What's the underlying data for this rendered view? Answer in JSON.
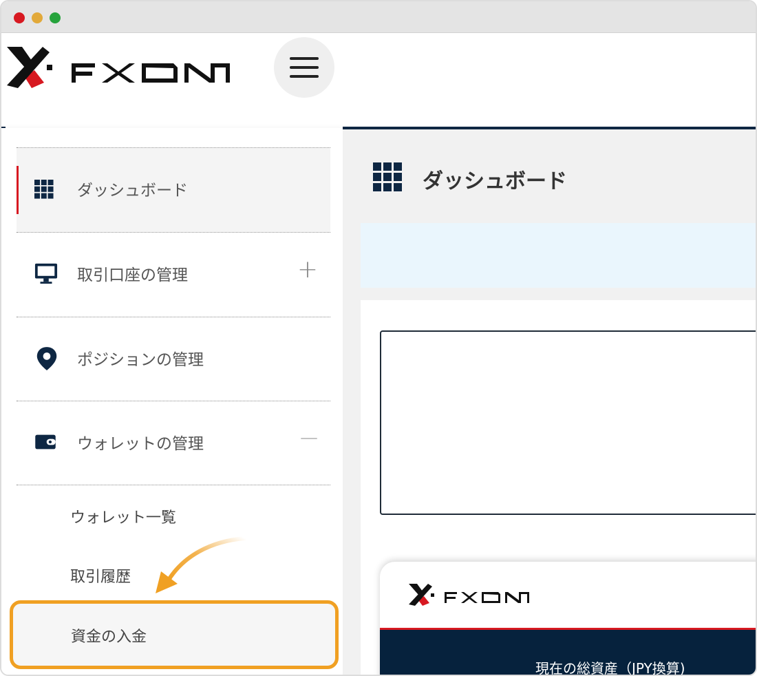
{
  "brand": {
    "name": "FXON",
    "logo_icon": "fxon-x-logo"
  },
  "header": {
    "menu_icon": "hamburger-menu-icon"
  },
  "sidebar": {
    "items": [
      {
        "label": "ダッシュボード",
        "icon": "grid-icon",
        "active": true
      },
      {
        "label": "取引口座の管理",
        "icon": "monitor-icon",
        "toggle": "+"
      },
      {
        "label": "ポジションの管理",
        "icon": "map-pin-icon"
      },
      {
        "label": "ウォレットの管理",
        "icon": "wallet-icon",
        "toggle": "—"
      }
    ],
    "wallet_subitems": [
      {
        "label": "ウォレット一覧"
      },
      {
        "label": "取引履歴"
      },
      {
        "label": "資金の入金",
        "highlighted": true
      }
    ]
  },
  "main": {
    "page_title": "ダッシュボード",
    "page_icon": "grid-icon",
    "asset_label": "現在の総資産（JPY換算)"
  },
  "colors": {
    "accent_red": "#d71921",
    "navy": "#0e2743",
    "highlight_orange": "#f0a023",
    "info_bg": "#eaf6fd"
  }
}
